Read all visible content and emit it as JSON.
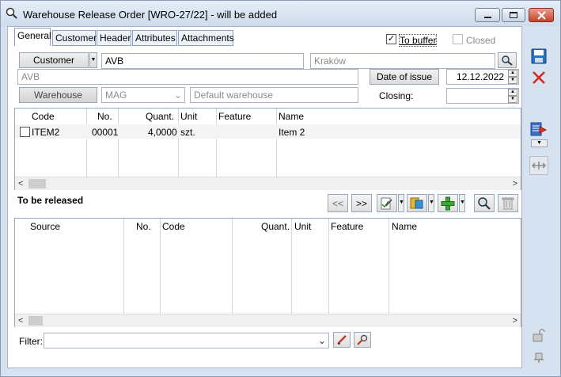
{
  "window": {
    "title": "Warehouse Release Order [WRO-27/22]  - will be added"
  },
  "tabs": [
    {
      "label": "General"
    },
    {
      "label": "Customer"
    },
    {
      "label": "Header"
    },
    {
      "label": "Attributes"
    },
    {
      "label": "Attachments"
    }
  ],
  "options": {
    "to_buffer_label": "To buffer",
    "to_buffer_checked": true,
    "closed_label": "Closed",
    "closed_checked": false
  },
  "header": {
    "customer_button": "Customer",
    "customer_code": "AVB",
    "customer_city": "Kraków",
    "customer_name": "AVB",
    "date_button": "Date of issue",
    "date_value": "12.12.2022",
    "warehouse_button": "Warehouse",
    "warehouse_code": "MAG",
    "warehouse_name": "Default warehouse",
    "closing_label": "Closing:",
    "closing_value": ""
  },
  "items_table": {
    "columns": [
      "Code",
      "No.",
      "Quant.",
      "Unit",
      "Feature",
      "Name"
    ],
    "rows": [
      {
        "code": "ITEM2",
        "no": "00001",
        "quant": "4,0000",
        "unit": "szt.",
        "feature": "",
        "name": "Item 2"
      }
    ]
  },
  "release": {
    "section_title": "To be released",
    "prev_label": "<<",
    "next_label": ">>",
    "columns": [
      "Source",
      "No.",
      "Code",
      "Quant.",
      "Unit",
      "Feature",
      "Name"
    ],
    "rows": []
  },
  "filter": {
    "label": "Filter:",
    "value": ""
  }
}
